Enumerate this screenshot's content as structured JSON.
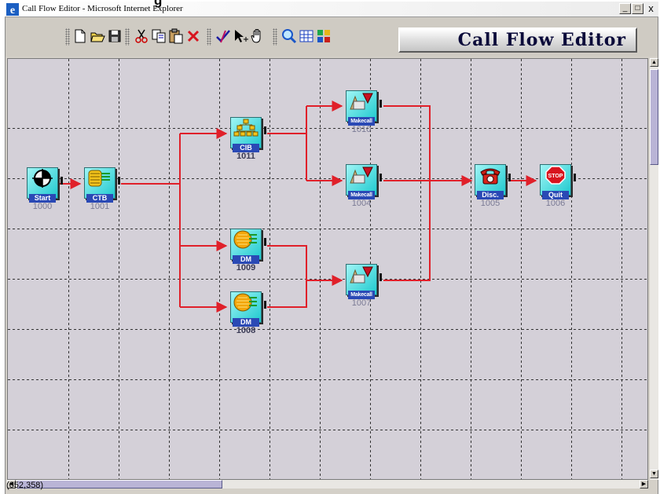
{
  "window": {
    "title": "Call Flow Editor - Microsoft Internet Explorer",
    "heading_fragment": "g",
    "minimize": "_",
    "maximize": "□",
    "close": "x"
  },
  "toolbar": {
    "groups": [
      [
        "new-icon",
        "open-icon",
        "save-icon"
      ],
      [
        "cut-icon",
        "copy-icon",
        "paste-icon",
        "delete-icon"
      ],
      [
        "check-icon",
        "pointer-add-icon",
        "hand-icon"
      ],
      [
        "zoom-icon",
        "grid-icon",
        "settings-icon"
      ]
    ]
  },
  "brand": {
    "title": "Call Flow Editor"
  },
  "nodes": {
    "start": {
      "label": "Start",
      "id": "1000",
      "icon": "target-icon"
    },
    "ctb": {
      "label": "CTB",
      "id": "1001",
      "icon": "ctb-icon"
    },
    "cib": {
      "label": "CIB",
      "id": "1011",
      "icon": "tree-icon"
    },
    "dm1009": {
      "label": "DM",
      "id": "1009",
      "icon": "dm-icon"
    },
    "dm1008": {
      "label": "DM",
      "id": "1008",
      "icon": "dm-icon"
    },
    "mc1010": {
      "label": "Makecall",
      "id": "1010",
      "icon": "makecall-icon"
    },
    "mc1004": {
      "label": "Makecall",
      "id": "1004",
      "icon": "makecall-icon"
    },
    "mc1007": {
      "label": "Makecall",
      "id": "1007",
      "icon": "makecall-icon"
    },
    "disc": {
      "label": "Disc.",
      "id": "1005",
      "icon": "telephone-icon"
    },
    "quit": {
      "label": "Quit",
      "id": "1006",
      "icon": "stop-sign-icon",
      "sign_text": "STOP"
    }
  },
  "status": {
    "coords": "(652,358)"
  },
  "colors": {
    "connector": "#e0202a",
    "tile": "#22c8d0",
    "label": "#2a49b5",
    "canvas": "#d4d0d8"
  }
}
